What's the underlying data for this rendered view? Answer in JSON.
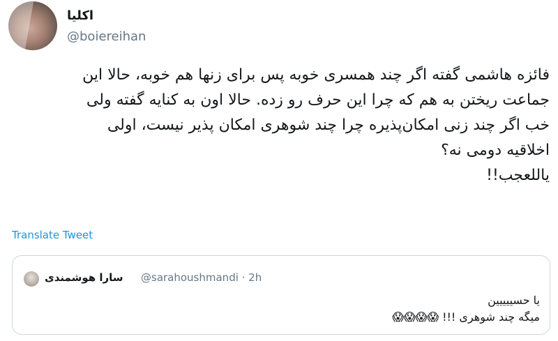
{
  "author": {
    "display_name": "اکلیا",
    "handle": "@boiereihan",
    "avatar_icon": "user-avatar"
  },
  "menu_icon": "chevron-down-icon",
  "tweet": {
    "text": "فائزه هاشمی گفته اگر چند همسری خوبه پس برای زنها هم خوبه، حالا این\nجماعت ریختن به هم که چرا این حرف رو زده. حالا اون به کنایه گفته ولی\nخب اگر چند زنی امکان‌پذیره چرا چند شوهری امکان پذیر نیست، اولی\nاخلاقیه دومی نه؟\nیاللعجب!!"
  },
  "translate": {
    "label": "Translate Tweet"
  },
  "quoted_tweet": {
    "display_name": "سارا هوشمندی",
    "meta": "@sarahoushmandi · 2h",
    "text": "یا حسییییین\nمیگه چند شوهری !!! 😱😱😱😱"
  },
  "colors": {
    "link": "#1b95e0",
    "secondary_text": "#657786",
    "border": "#ccd6dd"
  }
}
